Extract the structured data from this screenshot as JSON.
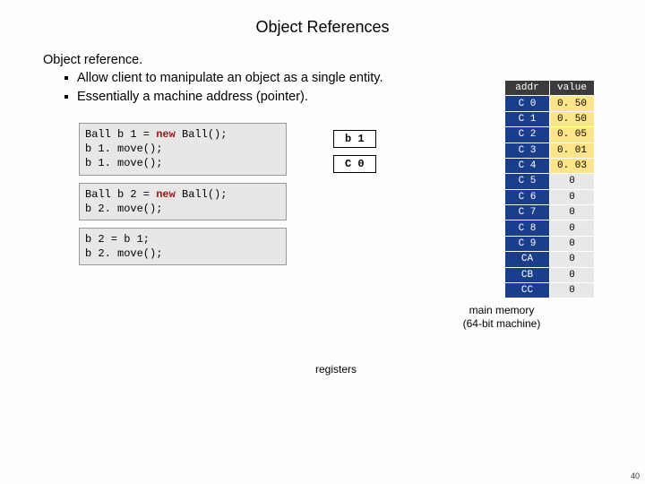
{
  "title": "Object References",
  "heading": "Object reference.",
  "bullets": [
    "Allow client to manipulate an object as a single entity.",
    "Essentially a machine address (pointer)."
  ],
  "code": {
    "block1": {
      "line1a": "Ball b 1 = ",
      "line1kw": "new",
      "line1b": " Ball();",
      "line2": "b 1. move();",
      "line3": "b 1. move();"
    },
    "block2": {
      "line1a": "Ball b 2 = ",
      "line1kw": "new",
      "line1b": " Ball();",
      "line2": "b 2. move();"
    },
    "block3": {
      "line1": "b 2 = b 1;",
      "line2": "b 2. move();"
    }
  },
  "registers": {
    "b1": "b 1",
    "c0": "C 0",
    "caption": "registers"
  },
  "memory": {
    "head_addr": "addr",
    "head_value": "value",
    "rows": [
      {
        "addr": "C 0",
        "val": "0. 50",
        "hl": true
      },
      {
        "addr": "C 1",
        "val": "0. 50",
        "hl": true
      },
      {
        "addr": "C 2",
        "val": "0. 05",
        "hl": true
      },
      {
        "addr": "C 3",
        "val": "0. 01",
        "hl": true
      },
      {
        "addr": "C 4",
        "val": "0. 03",
        "hl": true
      },
      {
        "addr": "C 5",
        "val": "0",
        "hl": false
      },
      {
        "addr": "C 6",
        "val": "0",
        "hl": false
      },
      {
        "addr": "C 7",
        "val": "0",
        "hl": false
      },
      {
        "addr": "C 8",
        "val": "0",
        "hl": false
      },
      {
        "addr": "C 9",
        "val": "0",
        "hl": false
      },
      {
        "addr": "CA",
        "val": "0",
        "hl": false
      },
      {
        "addr": "CB",
        "val": "0",
        "hl": false
      },
      {
        "addr": "CC",
        "val": "0",
        "hl": false
      }
    ],
    "caption1": "main memory",
    "caption2": "(64-bit machine)"
  },
  "pagenum": "40"
}
